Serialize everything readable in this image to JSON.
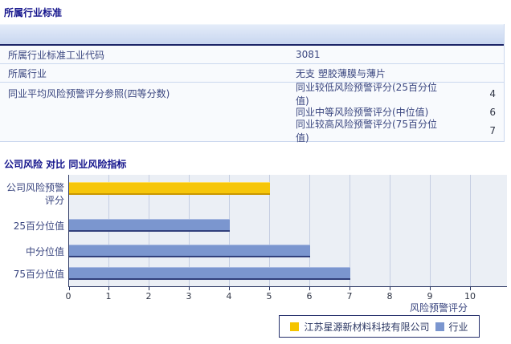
{
  "page": {
    "section1_title": "所属行业标准"
  },
  "table": {
    "rows": [
      {
        "label": "所属行业标准工业代码",
        "value": "3081"
      },
      {
        "label": "所属行业",
        "value": "无支 塑胶薄膜与薄片"
      }
    ],
    "group": {
      "label": "同业平均风险预警评分参照(四等分数)",
      "rows": [
        {
          "label": "同业较低风险预警评分(25百分位值)",
          "value": "4"
        },
        {
          "label": "同业中等风险预警评分(中位值)",
          "value": "6"
        },
        {
          "label": "同业较高风险预警评分(75百分位值)",
          "value": "7"
        }
      ]
    }
  },
  "chart_data": {
    "type": "bar",
    "orientation": "horizontal",
    "title": "公司风险 对比 同业风险指标",
    "categories": [
      "公司风险预警评分",
      "25百分位值",
      "中分位值",
      "75百分位值"
    ],
    "category_lines": [
      [
        "公司风险预警",
        "评分"
      ],
      [
        "25百分位值"
      ],
      [
        "中分位值"
      ],
      [
        "75百分位值"
      ]
    ],
    "values": [
      5,
      4,
      6,
      7
    ],
    "bar_series": [
      "company",
      "industry",
      "industry",
      "industry"
    ],
    "xlabel": "风险预警评分",
    "xlim": [
      0,
      10
    ],
    "x_ticks": [
      0,
      1,
      2,
      3,
      4,
      5,
      6,
      7,
      8,
      9,
      10
    ],
    "grid": true,
    "legend_position": "bottom",
    "legend": [
      {
        "name": "江苏星源新材料科技有限公司",
        "series": "company",
        "color": "#F5C400"
      },
      {
        "name": "行业",
        "series": "industry",
        "color": "#7B96CF"
      }
    ],
    "colors": {
      "company": "#F5C400",
      "industry": "#7B96CF",
      "plot_bg": "#EBEFF5",
      "axis": "#2B3763"
    }
  }
}
